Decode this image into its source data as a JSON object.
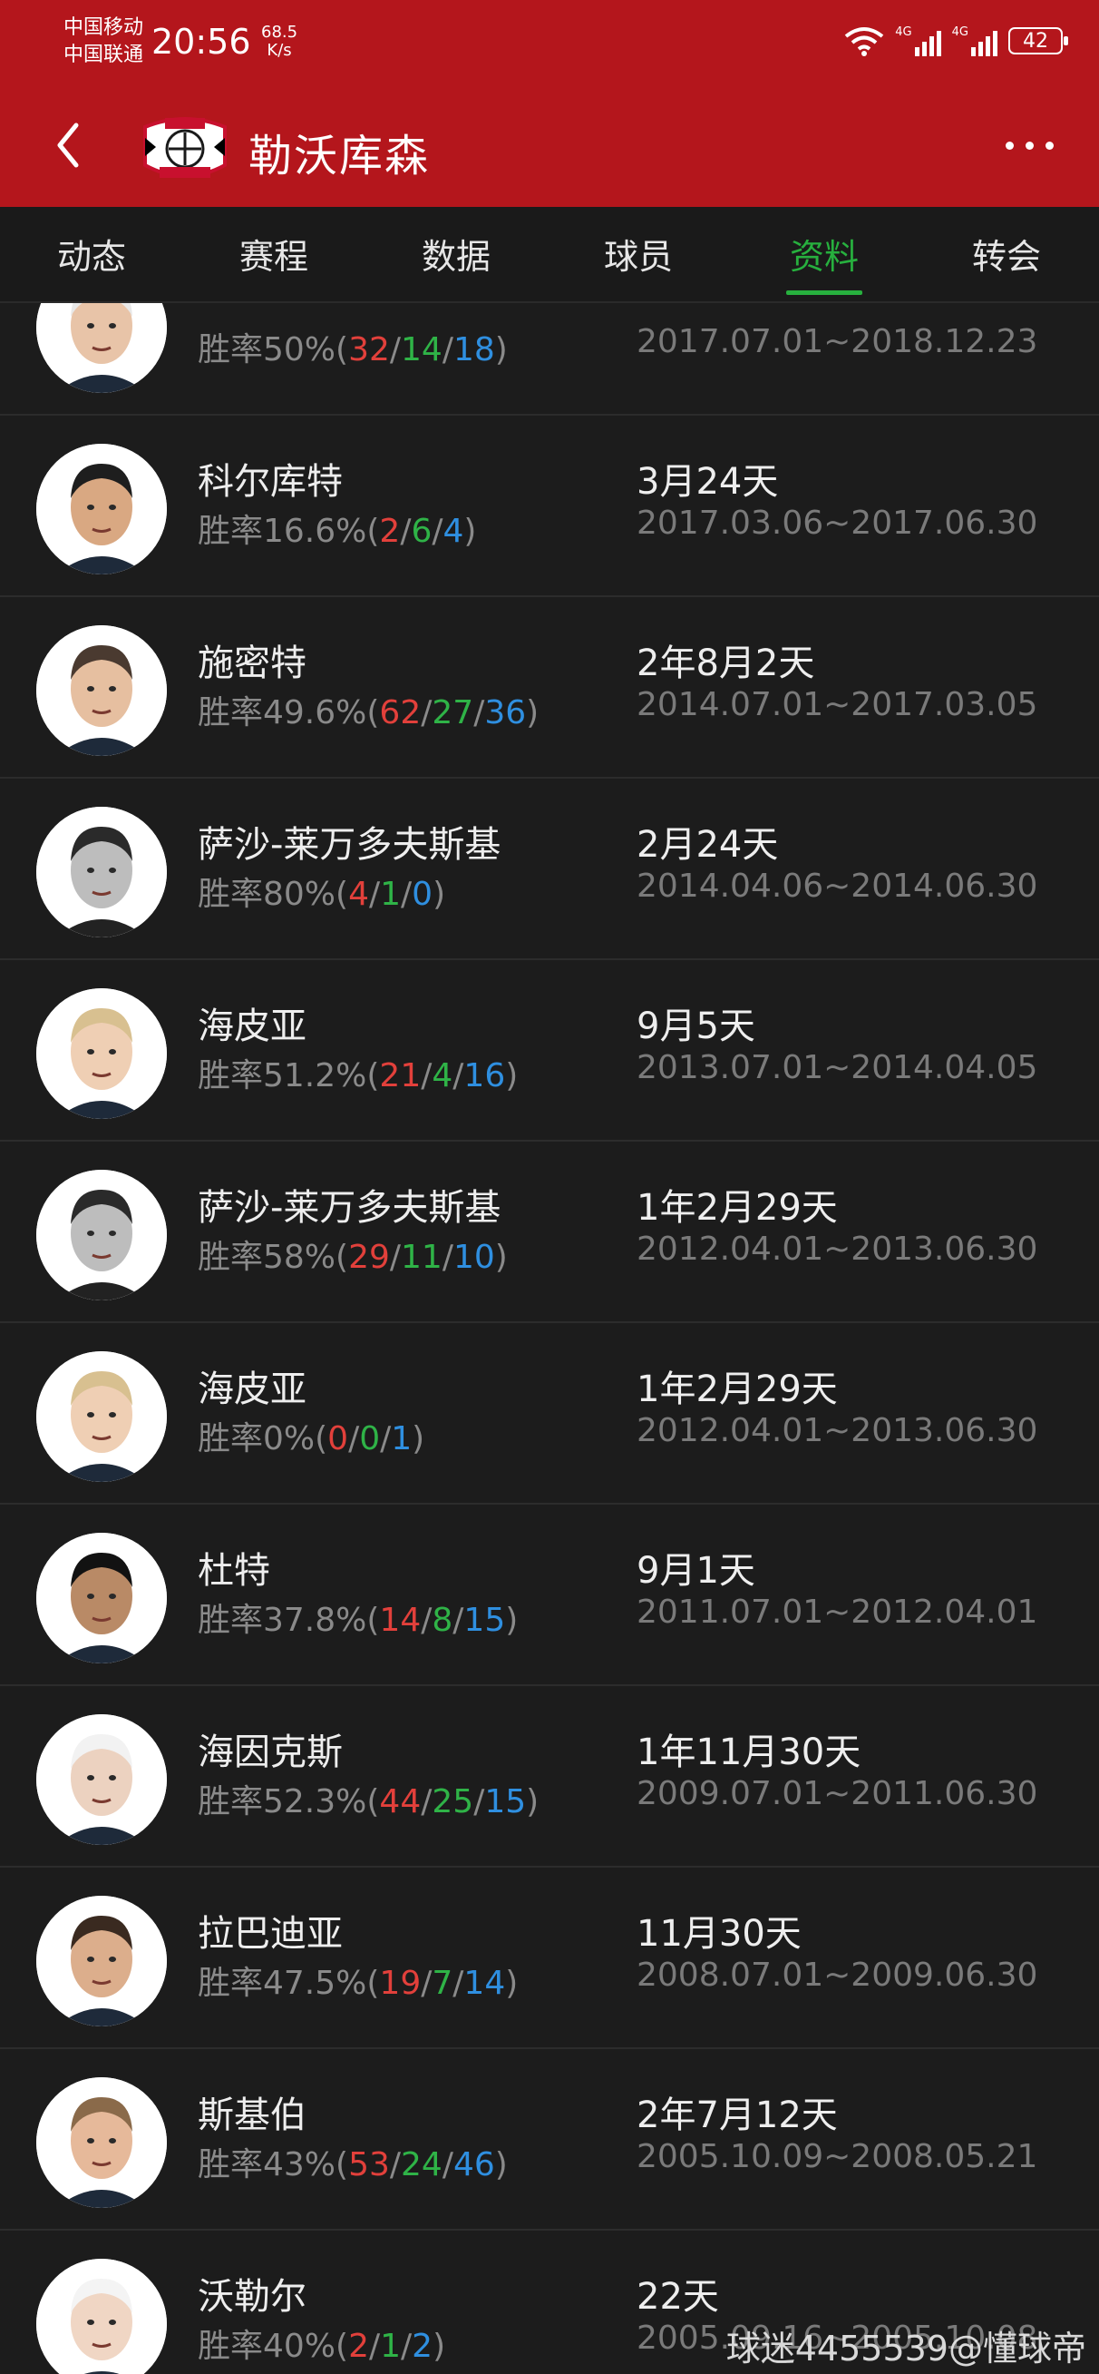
{
  "status_bar": {
    "carrier1": "中国移动",
    "carrier2": "中国联通",
    "time": "20:56",
    "speed_value": "68.5",
    "speed_unit": "K/s",
    "net1": "4G",
    "net2": "4G",
    "battery": "42"
  },
  "header": {
    "title": "勒沃库森",
    "logo_icon": "bayer-leverkusen-crest-icon",
    "back_icon": "chevron-left-icon",
    "more_icon": "more-horizontal-icon"
  },
  "tabs": [
    {
      "label": "动态",
      "active": false
    },
    {
      "label": "赛程",
      "active": false
    },
    {
      "label": "数据",
      "active": false
    },
    {
      "label": "球员",
      "active": false
    },
    {
      "label": "资料",
      "active": true
    },
    {
      "label": "转会",
      "active": false
    }
  ],
  "rate_prefix": "胜率",
  "coaches": [
    {
      "name": "",
      "rate": "50%",
      "w": "32",
      "d": "14",
      "l": "18",
      "duration": "",
      "period": "2017.07.01~2018.12.23"
    },
    {
      "name": "科尔库特",
      "rate": "16.6%",
      "w": "2",
      "d": "6",
      "l": "4",
      "duration": "3月24天",
      "period": "2017.03.06~2017.06.30"
    },
    {
      "name": "施密特",
      "rate": "49.6%",
      "w": "62",
      "d": "27",
      "l": "36",
      "duration": "2年8月2天",
      "period": "2014.07.01~2017.03.05"
    },
    {
      "name": "萨沙-莱万多夫斯基",
      "rate": "80%",
      "w": "4",
      "d": "1",
      "l": "0",
      "duration": "2月24天",
      "period": "2014.04.06~2014.06.30"
    },
    {
      "name": "海皮亚",
      "rate": "51.2%",
      "w": "21",
      "d": "4",
      "l": "16",
      "duration": "9月5天",
      "period": "2013.07.01~2014.04.05"
    },
    {
      "name": "萨沙-莱万多夫斯基",
      "rate": "58%",
      "w": "29",
      "d": "11",
      "l": "10",
      "duration": "1年2月29天",
      "period": "2012.04.01~2013.06.30"
    },
    {
      "name": "海皮亚",
      "rate": "0%",
      "w": "0",
      "d": "0",
      "l": "1",
      "duration": "1年2月29天",
      "period": "2012.04.01~2013.06.30"
    },
    {
      "name": "杜特",
      "rate": "37.8%",
      "w": "14",
      "d": "8",
      "l": "15",
      "duration": "9月1天",
      "period": "2011.07.01~2012.04.01"
    },
    {
      "name": "海因克斯",
      "rate": "52.3%",
      "w": "44",
      "d": "25",
      "l": "15",
      "duration": "1年11月30天",
      "period": "2009.07.01~2011.06.30"
    },
    {
      "name": "拉巴迪亚",
      "rate": "47.5%",
      "w": "19",
      "d": "7",
      "l": "14",
      "duration": "11月30天",
      "period": "2008.07.01~2009.06.30"
    },
    {
      "name": "斯基伯",
      "rate": "43%",
      "w": "53",
      "d": "24",
      "l": "46",
      "duration": "2年7月12天",
      "period": "2005.10.09~2008.05.21"
    },
    {
      "name": "沃勒尔",
      "rate": "40%",
      "w": "2",
      "d": "1",
      "l": "2",
      "duration": "22天",
      "period": "2005.09.16~2005.10.08"
    }
  ],
  "watermark": "球迷4455539@懂球帝",
  "colors": {
    "header_bg": "#b4161c",
    "tab_active": "#27b03e",
    "win": "#e2403b",
    "draw": "#2fb347",
    "loss": "#2f8fe0"
  }
}
